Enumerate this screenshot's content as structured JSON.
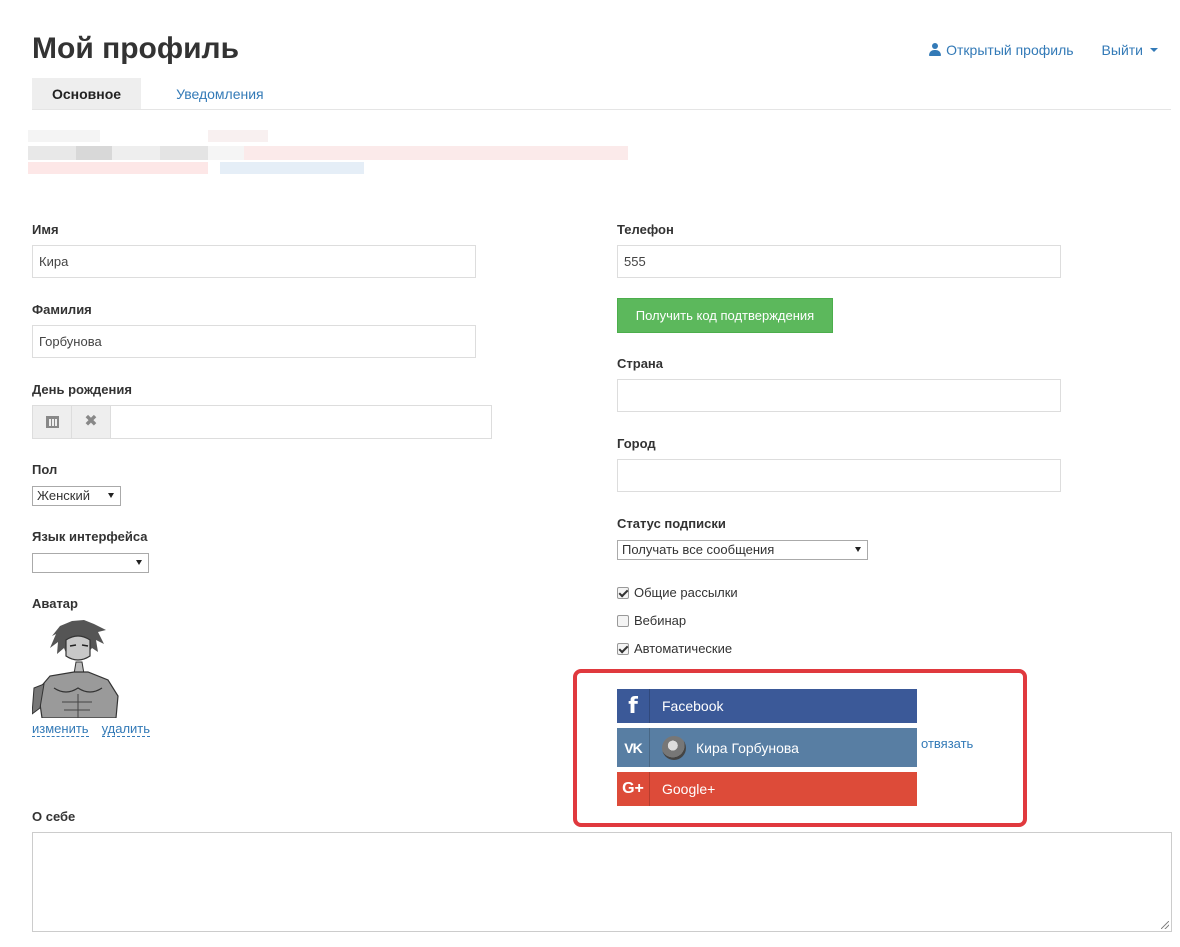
{
  "header": {
    "title": "Мой профиль",
    "public_profile": "Открытый профиль",
    "logout": "Выйти"
  },
  "tabs": [
    {
      "label": "Основное",
      "active": true
    },
    {
      "label": "Уведомления",
      "active": false
    }
  ],
  "left": {
    "first_name_label": "Имя",
    "first_name_value": "Кира",
    "last_name_label": "Фамилия",
    "last_name_value": "Горбунова",
    "birthday_label": "День рождения",
    "birthday_value": "",
    "gender_label": "Пол",
    "gender_value": "Женский",
    "language_label": "Язык интерфейса",
    "language_value": "",
    "avatar_label": "Аватар",
    "avatar_change": "изменить",
    "avatar_delete": "удалить"
  },
  "right": {
    "phone_label": "Телефон",
    "phone_value": "555",
    "get_code_button": "Получить код подтверждения",
    "country_label": "Страна",
    "country_value": "",
    "city_label": "Город",
    "city_value": "",
    "subscription_label": "Статус подписки",
    "subscription_value": "Получать все сообщения",
    "checkboxes": [
      {
        "label": "Общие рассылки",
        "checked": true
      },
      {
        "label": "Вебинар",
        "checked": false
      },
      {
        "label": "Автоматические",
        "checked": true
      }
    ]
  },
  "social": {
    "facebook_label": "Facebook",
    "vk_label": "Кира Горбунова",
    "vk_unlink": "отвязать",
    "google_label": "Google+",
    "facebook_icon_glyph": "f",
    "vk_icon_glyph": "VK",
    "google_icon_glyph": "G+",
    "colors": {
      "facebook": "#3b5998",
      "vk": "#587ea3",
      "google": "#dd4b39",
      "highlight": "#e0393e"
    }
  },
  "about": {
    "label": "О себе",
    "value": ""
  }
}
